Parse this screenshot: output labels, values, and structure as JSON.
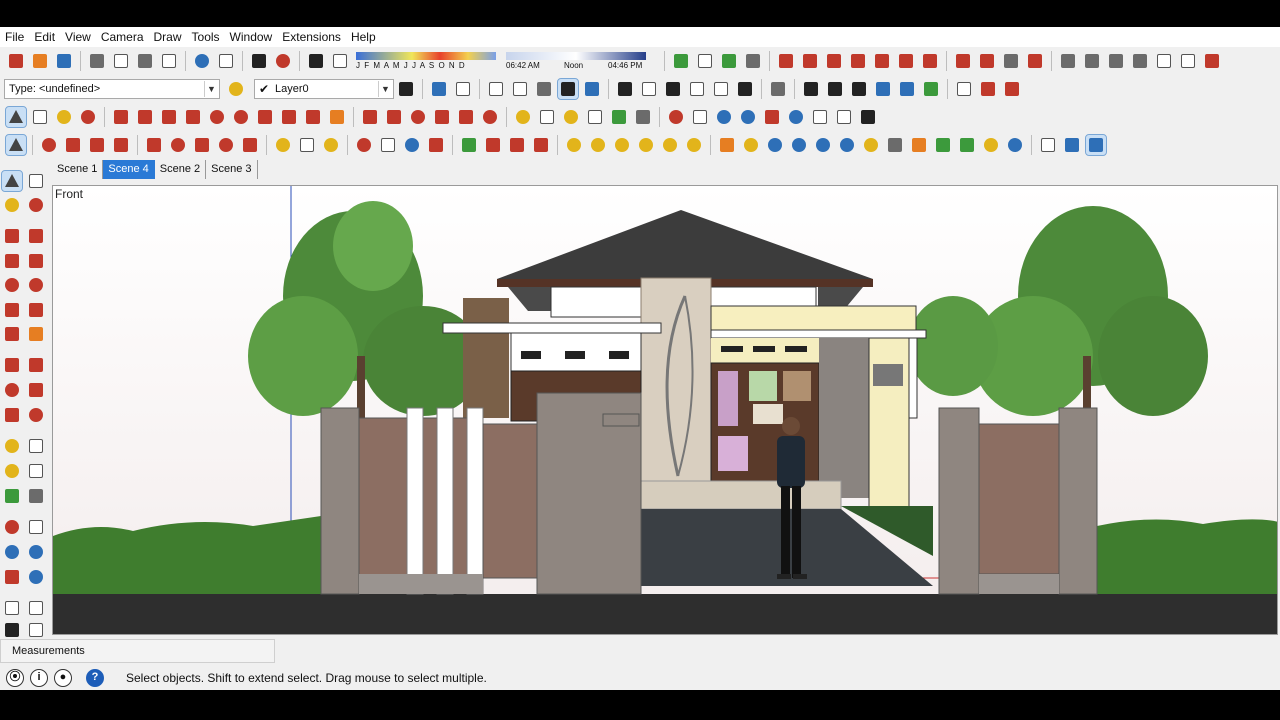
{
  "menu": [
    "File",
    "Edit",
    "View",
    "Camera",
    "Draw",
    "Tools",
    "Window",
    "Extensions",
    "Help"
  ],
  "toolbar": {
    "type_value": "Type: <undefined>",
    "layer_value": "Layer0",
    "shadow": {
      "months": "J F M A M J J A S O N D",
      "time_start": "06:42 AM",
      "time_mid": "Noon",
      "time_end": "04:46 PM"
    }
  },
  "scenes": [
    "Scene 1",
    "Scene 4",
    "Scene 2",
    "Scene 3"
  ],
  "active_scene": "Scene 4",
  "viewport": {
    "label": "Front"
  },
  "measurements_label": "Measurements",
  "status": {
    "message": "Select objects. Shift to extend select. Drag mouse to select multiple."
  },
  "colors": {
    "accent": "#2a7ad6",
    "roof": "#3c3c3c",
    "wall": "#8f8680"
  }
}
